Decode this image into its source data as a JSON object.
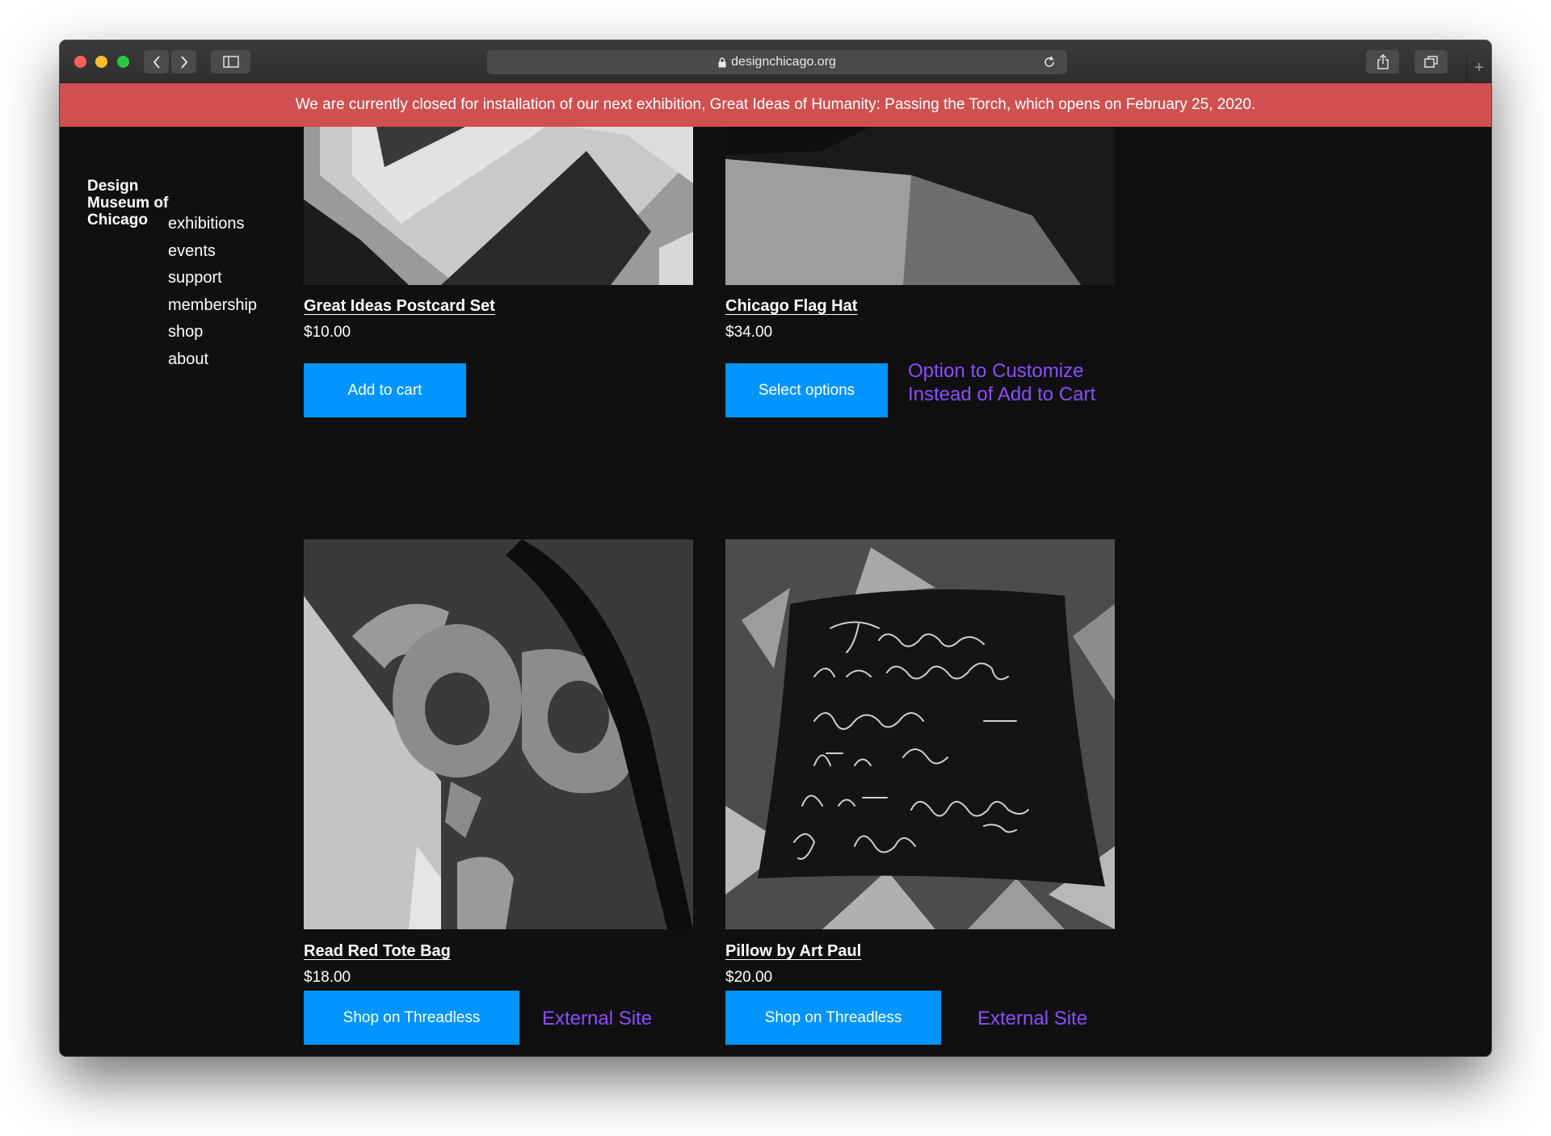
{
  "browser": {
    "url": "designchicago.org",
    "new_tab_label": "+"
  },
  "banner": {
    "text": "We are currently closed for installation of our next exhibition, Great Ideas of Humanity: Passing the Torch, which opens on February 25, 2020."
  },
  "site": {
    "logo_lines": [
      "Design",
      "Museum of",
      "Chicago"
    ],
    "nav": [
      "exhibitions",
      "events",
      "support",
      "membership",
      "shop",
      "about"
    ]
  },
  "products": [
    {
      "title": "Great Ideas Postcard Set",
      "price": "$10.00",
      "button": "Add to cart"
    },
    {
      "title": "Chicago Flag Hat",
      "price": "$34.00",
      "button": "Select options"
    },
    {
      "title": "Read Red Tote Bag",
      "price": "$18.00",
      "button": "Shop on Threadless"
    },
    {
      "title": "Pillow by Art Paul",
      "price": "$20.00",
      "button": "Shop on Threadless"
    }
  ],
  "annotations": {
    "customize": [
      "Option to Customize",
      "Instead of Add to Cart"
    ],
    "external_1": "External Site",
    "external_2": "External Site"
  },
  "colors": {
    "banner": "#d05050",
    "button": "#0094ff",
    "annotation": "#8a4dff",
    "page": "#101010"
  }
}
